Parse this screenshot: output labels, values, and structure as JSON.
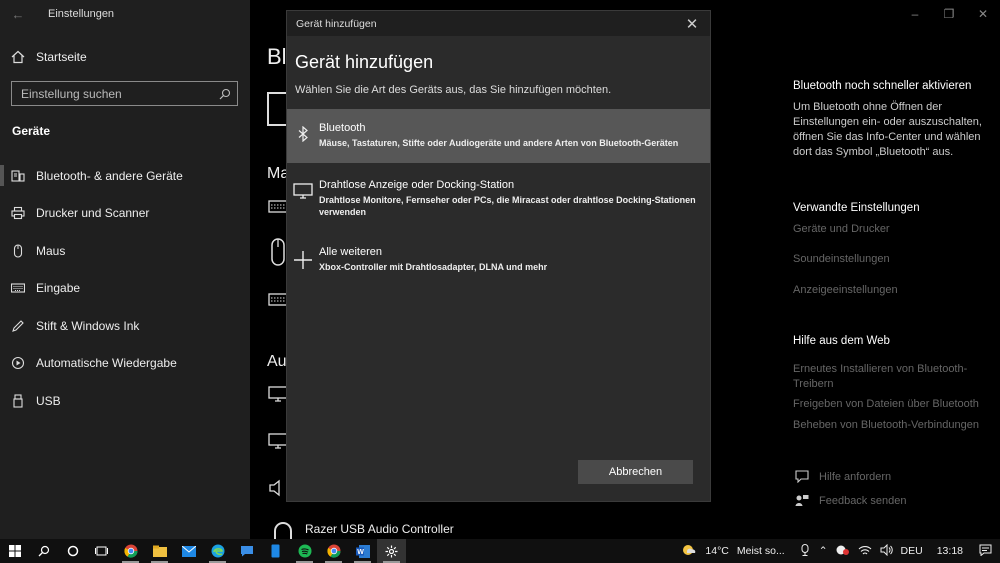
{
  "app": {
    "title": "Einstellungen",
    "back_icon": "back-arrow-icon"
  },
  "sidebar": {
    "home_label": "Startseite",
    "search_placeholder": "Einstellung suchen",
    "section_title": "Geräte",
    "items": [
      {
        "label": "Bluetooth- & andere Geräte",
        "icon": "bluetooth-devices-icon",
        "active": true
      },
      {
        "label": "Drucker und Scanner",
        "icon": "printer-icon"
      },
      {
        "label": "Maus",
        "icon": "mouse-icon"
      },
      {
        "label": "Eingabe",
        "icon": "keyboard-icon"
      },
      {
        "label": "Stift & Windows Ink",
        "icon": "pen-icon"
      },
      {
        "label": "Automatische Wiedergabe",
        "icon": "autoplay-icon"
      },
      {
        "label": "USB",
        "icon": "usb-icon"
      }
    ]
  },
  "background": {
    "heading_fragment": "Bl",
    "sub1_fragment": "Ma",
    "sub2_fragment": "Au",
    "device_label": "Razer USB Audio Controller"
  },
  "right_panel": {
    "promo_title": "Bluetooth noch schneller aktivieren",
    "promo_text": "Um Bluetooth ohne Öffnen der Einstellungen ein- oder auszuschalten, öffnen Sie das Info-Center und wählen dort das Symbol „Bluetooth“ aus.",
    "related_title": "Verwandte Einstellungen",
    "related_links": [
      "Geräte und Drucker",
      "Soundeinstellungen",
      "Anzeigeeinstellungen"
    ],
    "help_title": "Hilfe aus dem Web",
    "help_links": [
      "Erneutes Installieren von Bluetooth-Treibern",
      "Freigeben von Dateien über Bluetooth",
      "Beheben von Bluetooth-Verbindungen"
    ],
    "help_request": "Hilfe anfordern",
    "feedback": "Feedback senden"
  },
  "dialog": {
    "titlebar": "Gerät hinzufügen",
    "heading": "Gerät hinzufügen",
    "instruction": "Wählen Sie die Art des Geräts aus, das Sie hinzufügen möchten.",
    "options": [
      {
        "title": "Bluetooth",
        "desc": "Mäuse, Tastaturen, Stifte oder Audiogeräte und andere Arten von Bluetooth-Geräten",
        "icon": "bluetooth-icon",
        "selected": true
      },
      {
        "title": "Drahtlose Anzeige oder Docking-Station",
        "desc": "Drahtlose Monitore, Fernseher oder PCs, die Miracast oder drahtlose Docking-Stationen verwenden",
        "icon": "monitor-icon"
      },
      {
        "title": "Alle weiteren",
        "desc": "Xbox-Controller mit Drahtlosadapter, DLNA und mehr",
        "icon": "plus-icon"
      }
    ],
    "cancel_label": "Abbrechen"
  },
  "taskbar": {
    "weather": "14°C",
    "weather_text": "Meist so...",
    "language": "DEU",
    "time": "13:18"
  }
}
